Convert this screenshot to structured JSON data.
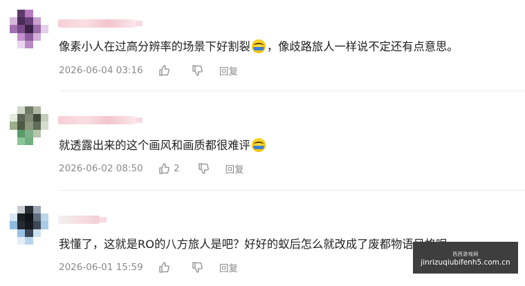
{
  "comments": [
    {
      "username": "",
      "text_before": "像素小人在过高分辨率的场景下好割裂",
      "emoji": "laughing-tears-emoji",
      "text_after": "，像歧路旅人一样说不定还有点意思。",
      "date": "2026-06-04 03:16",
      "likes": "",
      "reply_label": "回复"
    },
    {
      "username": "",
      "text_before": "就透露出来的这个画风和画质都很难评",
      "emoji": "laughing-tears-emoji",
      "text_after": "",
      "date": "2026-06-02 08:50",
      "likes": "2",
      "reply_label": "回复"
    },
    {
      "username": "",
      "text_before": "我懂了，这就是RO的八方旅人是吧？好好的蚁后怎么就改成了废都物语风格呢",
      "emoji": "",
      "text_after": "",
      "date": "2026-06-01 15:59",
      "likes": "",
      "reply_label": "回复"
    }
  ],
  "watermark": {
    "top": "西西游戏网",
    "bottom": "jinrizuqiubifenh5.com.cn"
  },
  "colors": {
    "text": "#1f1f1f",
    "meta": "#8a8a8a",
    "divider": "#ececec"
  }
}
